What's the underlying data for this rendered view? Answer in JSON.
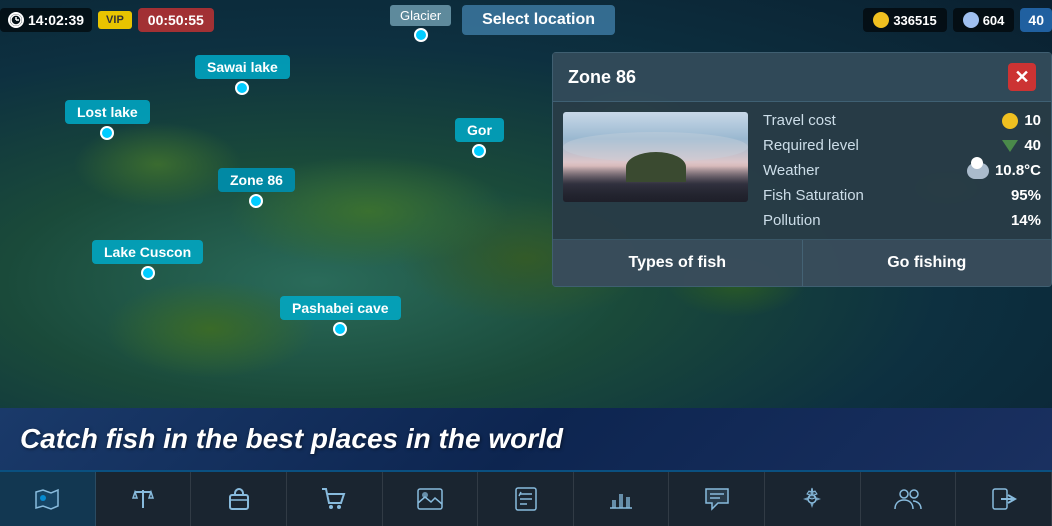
{
  "topBar": {
    "time": "14:02:39",
    "vip": "VIP",
    "timer": "00:50:55",
    "selectLocation": "Select location",
    "coins": "336515",
    "diamonds": "604",
    "level": "40"
  },
  "locations": [
    {
      "id": "sawai",
      "label": "Sawai lake",
      "active": false
    },
    {
      "id": "lost",
      "label": "Lost lake",
      "active": false
    },
    {
      "id": "zone86",
      "label": "Zone 86",
      "active": true
    },
    {
      "id": "cuscon",
      "label": "Lake Cuscon",
      "active": false
    },
    {
      "id": "pashabei",
      "label": "Pashabei cave",
      "active": false
    },
    {
      "id": "glacier",
      "label": "Glacier",
      "active": false
    },
    {
      "id": "gor",
      "label": "Gor",
      "active": false
    }
  ],
  "zonePanel": {
    "title": "Zone 86",
    "travelCostLabel": "Travel cost",
    "travelCostValue": "10",
    "requiredLevelLabel": "Required level",
    "requiredLevelValue": "40",
    "weatherLabel": "Weather",
    "weatherValue": "10.8°C",
    "fishSaturationLabel": "Fish Saturation",
    "fishSaturationValue": "95%",
    "pollutionLabel": "Pollution",
    "pollutionValue": "14%",
    "typesOfFishBtn": "Types of fish",
    "goFishingBtn": "Go fishing"
  },
  "banner": {
    "text": "Catch fish in the best places in the world"
  },
  "bottomNav": [
    {
      "id": "map",
      "icon": "🗺",
      "active": true
    },
    {
      "id": "scales",
      "icon": "⚖"
    },
    {
      "id": "bag",
      "icon": "💼"
    },
    {
      "id": "cart",
      "icon": "🛒"
    },
    {
      "id": "gallery",
      "icon": "🖼"
    },
    {
      "id": "checklist",
      "icon": "📋"
    },
    {
      "id": "chart",
      "icon": "📊"
    },
    {
      "id": "chat",
      "icon": "💬"
    },
    {
      "id": "settings",
      "icon": "⚙"
    },
    {
      "id": "people",
      "icon": "👥"
    },
    {
      "id": "exit",
      "icon": "🚪"
    }
  ]
}
